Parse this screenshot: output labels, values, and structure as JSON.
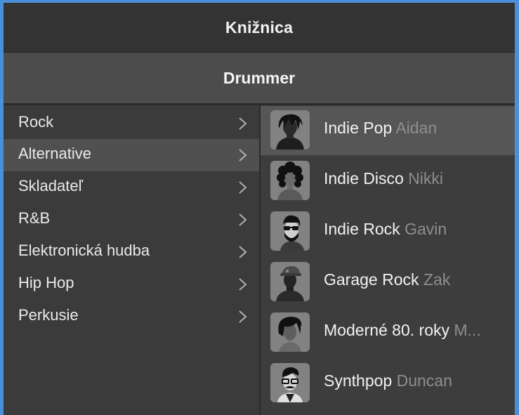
{
  "window": {
    "title": "Knižnica"
  },
  "header": {
    "title": "Drummer"
  },
  "categories": [
    {
      "label": "Rock",
      "selected": false
    },
    {
      "label": "Alternative",
      "selected": true
    },
    {
      "label": "Skladateľ",
      "selected": false
    },
    {
      "label": "R&B",
      "selected": false
    },
    {
      "label": "Elektronická hudba",
      "selected": false
    },
    {
      "label": "Hip Hop",
      "selected": false
    },
    {
      "label": "Perkusie",
      "selected": false
    }
  ],
  "drummers": [
    {
      "genre": "Indie Pop",
      "name": "Aidan",
      "selected": true,
      "icon": "drummer-avatar-shaggy-hair"
    },
    {
      "genre": "Indie Disco",
      "name": "Nikki",
      "selected": false,
      "icon": "drummer-avatar-curly-hair"
    },
    {
      "genre": "Indie Rock",
      "name": "Gavin",
      "selected": false,
      "icon": "drummer-avatar-sunglasses-beard"
    },
    {
      "genre": "Garage Rock",
      "name": "Zak",
      "selected": false,
      "icon": "drummer-avatar-cap"
    },
    {
      "genre": "Moderné 80. roky",
      "name": "M...",
      "selected": false,
      "icon": "drummer-avatar-side-bangs"
    },
    {
      "genre": "Synthpop",
      "name": "Duncan",
      "selected": false,
      "icon": "drummer-avatar-glasses-mustache"
    }
  ],
  "colors": {
    "title_bar": "#333333",
    "header_bar": "#4c4c4c",
    "selection": "#565656",
    "border": "#4a90d9"
  }
}
